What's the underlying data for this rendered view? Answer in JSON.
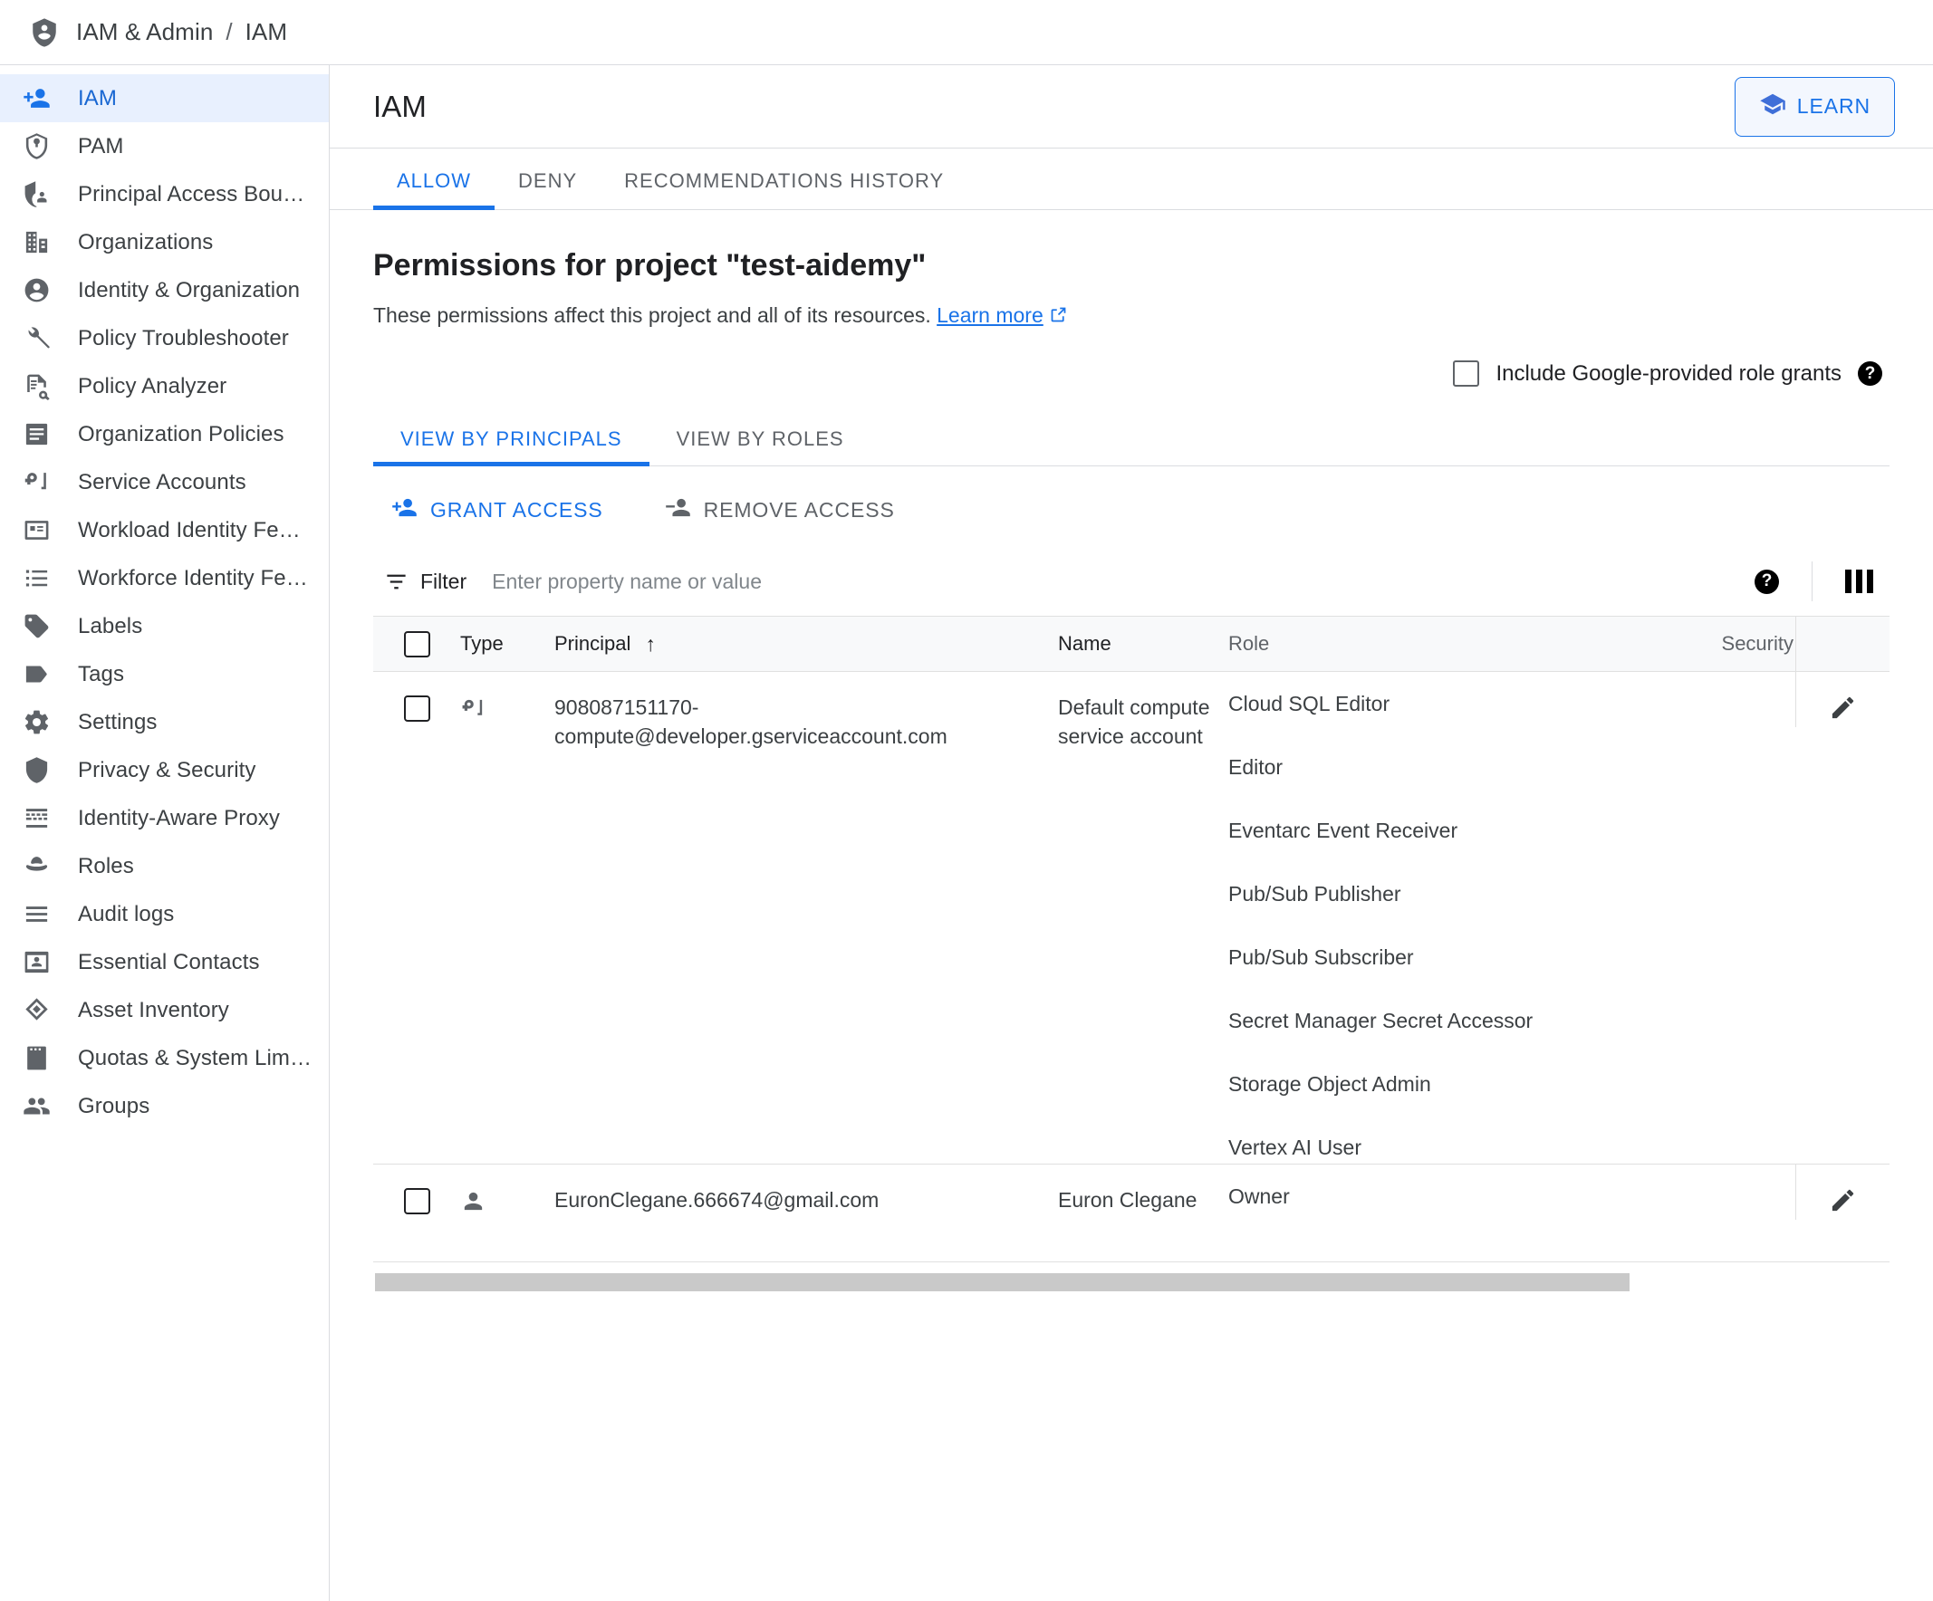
{
  "breadcrumb": {
    "icon": "shield-person-icon",
    "root": "IAM & Admin",
    "separator": "/",
    "current": "IAM"
  },
  "sidebar": {
    "items": [
      {
        "label": "IAM",
        "icon": "person-add-icon",
        "active": true
      },
      {
        "label": "PAM",
        "icon": "shield-key-icon",
        "active": false
      },
      {
        "label": "Principal Access Boundary",
        "icon": "shield-user-icon",
        "active": false
      },
      {
        "label": "Organizations",
        "icon": "building-icon",
        "active": false
      },
      {
        "label": "Identity & Organization",
        "icon": "account-circle-icon",
        "active": false
      },
      {
        "label": "Policy Troubleshooter",
        "icon": "wrench-icon",
        "active": false
      },
      {
        "label": "Policy Analyzer",
        "icon": "document-search-icon",
        "active": false
      },
      {
        "label": "Organization Policies",
        "icon": "list-document-icon",
        "active": false
      },
      {
        "label": "Service Accounts",
        "icon": "key-card-icon",
        "active": false
      },
      {
        "label": "Workload Identity Federat…",
        "icon": "id-card-icon",
        "active": false
      },
      {
        "label": "Workforce Identity Federa…",
        "icon": "bullet-list-icon",
        "active": false
      },
      {
        "label": "Labels",
        "icon": "label-tag-icon",
        "active": false
      },
      {
        "label": "Tags",
        "icon": "tag-arrow-icon",
        "active": false
      },
      {
        "label": "Settings",
        "icon": "gear-icon",
        "active": false
      },
      {
        "label": "Privacy & Security",
        "icon": "shield-icon",
        "active": false
      },
      {
        "label": "Identity-Aware Proxy",
        "icon": "proxy-icon",
        "active": false
      },
      {
        "label": "Roles",
        "icon": "hat-icon",
        "active": false
      },
      {
        "label": "Audit logs",
        "icon": "lines-icon",
        "active": false
      },
      {
        "label": "Essential Contacts",
        "icon": "contact-card-icon",
        "active": false
      },
      {
        "label": "Asset Inventory",
        "icon": "diamond-layers-icon",
        "active": false
      },
      {
        "label": "Quotas & System Limits",
        "icon": "quota-icon",
        "active": false
      },
      {
        "label": "Groups",
        "icon": "people-icon",
        "active": false
      }
    ]
  },
  "header": {
    "title": "IAM",
    "learn_button": {
      "label": "LEARN",
      "icon": "graduation-cap-icon"
    }
  },
  "tabs": [
    {
      "label": "ALLOW",
      "active": true
    },
    {
      "label": "DENY",
      "active": false
    },
    {
      "label": "RECOMMENDATIONS HISTORY",
      "active": false
    }
  ],
  "permissions": {
    "title": "Permissions for project \"test-aidemy\"",
    "description": "These permissions affect this project and all of its resources.",
    "learn_more": "Learn more",
    "learn_more_icon": "external-link-icon"
  },
  "include_grants": {
    "label": "Include Google-provided role grants",
    "checked": false,
    "help_icon": "help-icon"
  },
  "subtabs": [
    {
      "label": "VIEW BY PRINCIPALS",
      "active": true
    },
    {
      "label": "VIEW BY ROLES",
      "active": false
    }
  ],
  "actions": [
    {
      "label": "GRANT ACCESS",
      "icon": "person-add-icon",
      "style": "primary"
    },
    {
      "label": "REMOVE ACCESS",
      "icon": "person-remove-icon",
      "style": "muted"
    }
  ],
  "filter": {
    "icon": "filter-icon",
    "label": "Filter",
    "placeholder": "Enter property name or value",
    "value": "",
    "help_icon": "help-icon",
    "columns_icon": "columns-icon"
  },
  "table": {
    "select_all_checked": false,
    "columns": [
      {
        "key": "type",
        "label": "Type"
      },
      {
        "key": "principal",
        "label": "Principal",
        "sorted": "asc",
        "sort_icon": "arrow-up-icon"
      },
      {
        "key": "name",
        "label": "Name"
      },
      {
        "key": "role",
        "label": "Role"
      },
      {
        "key": "security",
        "label": "Security"
      }
    ],
    "rows": [
      {
        "type_icon": "key-card-icon",
        "checked": false,
        "principal": "908087151170-compute@developer.gserviceaccount.com",
        "name": "Default compute service account",
        "roles": [
          "Cloud SQL Editor",
          "Editor",
          "Eventarc Event Receiver",
          "Pub/Sub Publisher",
          "Pub/Sub Subscriber",
          "Secret Manager Secret Accessor",
          "Storage Object Admin",
          "Vertex AI User"
        ],
        "security": "",
        "edit_icon": "pencil-icon"
      },
      {
        "type_icon": "person-icon",
        "checked": false,
        "principal": "EuronClegane.666674@gmail.com",
        "name": "Euron Clegane",
        "roles": [
          "Owner"
        ],
        "security": "",
        "edit_icon": "pencil-icon"
      }
    ]
  },
  "colors": {
    "accent": "#1a73e8",
    "accent_light": "#e8f0fe",
    "text": "#202124",
    "text_muted": "#5f6368",
    "border": "#dadce0",
    "header_bg": "#f8f9fa",
    "scrollbar": "#c9c9c9"
  }
}
